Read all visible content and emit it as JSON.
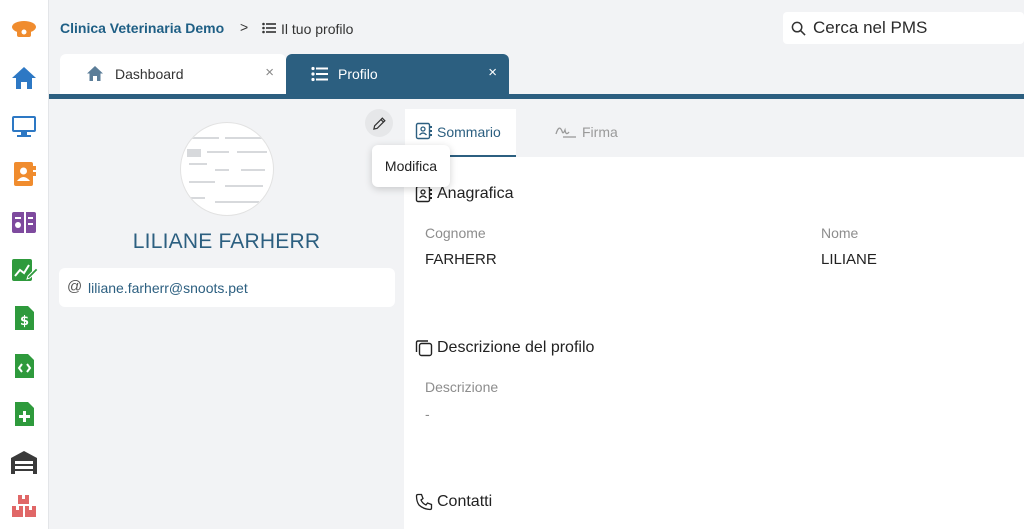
{
  "header": {
    "app_name": "Clinica Veterinaria Demo",
    "separator": ">",
    "page": "Il tuo profilo"
  },
  "search": {
    "placeholder": "Cerca nel PMS"
  },
  "tabs": [
    {
      "label": "Dashboard",
      "icon": "home-icon",
      "close": "×"
    },
    {
      "label": "Profilo",
      "icon": "list-icon",
      "close": "×"
    }
  ],
  "rail": {
    "icons": [
      "phone-icon",
      "home-icon",
      "monitor-icon",
      "contact-book-icon",
      "calendar-icon",
      "chart-edit-icon",
      "invoice-icon",
      "code-file-icon",
      "add-file-icon",
      "warehouse-icon",
      "boxes-icon"
    ],
    "colors": {
      "orange": "#f08c2e",
      "blue": "#2d78c4",
      "purple": "#7e4a9e",
      "green": "#2e9a3c",
      "dark": "#3a3a3a",
      "red": "#e06767"
    }
  },
  "profile": {
    "name": "LILIANE FARHERR",
    "email_symbol": "@",
    "email": "liliane.farherr@snoots.pet"
  },
  "tooltip": {
    "text": "Modifica"
  },
  "subtabs": {
    "summary": "Sommario",
    "signature": "Firma"
  },
  "sections": {
    "anagrafica": {
      "title": "Anagrafica",
      "cognome_label": "Cognome",
      "cognome_value": "FARHERR",
      "nome_label": "Nome",
      "nome_value": "LILIANE"
    },
    "descrizione": {
      "title": "Descrizione del profilo",
      "label": "Descrizione",
      "value": "-"
    },
    "contatti": {
      "title": "Contatti"
    }
  },
  "colors": {
    "accent": "#2c5f80",
    "background": "#f2f3f5"
  }
}
